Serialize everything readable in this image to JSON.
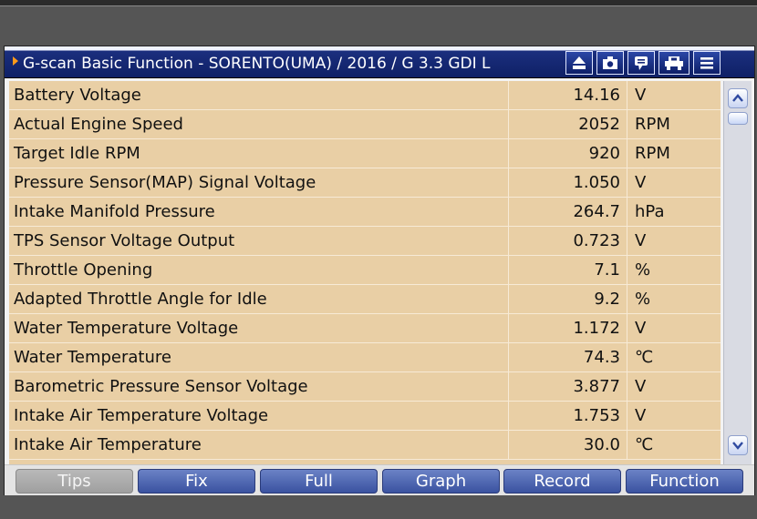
{
  "window": {
    "title": "G-scan Basic Function - SORENTO(UMA) / 2016 / G 3.3 GDI L",
    "toolbar_icons": [
      "eject-icon",
      "camera-icon",
      "chat-bubble-icon",
      "vehicle-icon",
      "menu-icon"
    ]
  },
  "table": {
    "rows": [
      {
        "name": "Battery Voltage",
        "value": "14.16",
        "unit": "V"
      },
      {
        "name": "Actual Engine Speed",
        "value": "2052",
        "unit": "RPM"
      },
      {
        "name": "Target Idle RPM",
        "value": "920",
        "unit": "RPM"
      },
      {
        "name": "Pressure Sensor(MAP) Signal Voltage",
        "value": "1.050",
        "unit": "V"
      },
      {
        "name": "Intake Manifold Pressure",
        "value": "264.7",
        "unit": "hPa"
      },
      {
        "name": "TPS Sensor Voltage Output",
        "value": "0.723",
        "unit": "V"
      },
      {
        "name": "Throttle Opening",
        "value": "7.1",
        "unit": "%"
      },
      {
        "name": "Adapted Throttle Angle for Idle",
        "value": "9.2",
        "unit": "%"
      },
      {
        "name": "Water Temperature Voltage",
        "value": "1.172",
        "unit": "V"
      },
      {
        "name": "Water Temperature",
        "value": "74.3",
        "unit": "℃"
      },
      {
        "name": "Barometric Pressure Sensor Voltage",
        "value": "3.877",
        "unit": "V"
      },
      {
        "name": "Intake Air Temperature Voltage",
        "value": "1.753",
        "unit": "V"
      },
      {
        "name": "Intake Air Temperature",
        "value": "30.0",
        "unit": "℃"
      }
    ]
  },
  "bottom_buttons": [
    {
      "label": "Tips",
      "enabled": false
    },
    {
      "label": "Fix",
      "enabled": true
    },
    {
      "label": "Full",
      "enabled": true
    },
    {
      "label": "Graph",
      "enabled": true
    },
    {
      "label": "Record",
      "enabled": true
    },
    {
      "label": "Function",
      "enabled": true
    }
  ],
  "colors": {
    "titlebar": "#0f2066",
    "table_bg": "#e9cfa5",
    "button": "#4a62b0",
    "button_disabled": "#aaaaaa",
    "accent_arrow": "#ff9a1a"
  }
}
